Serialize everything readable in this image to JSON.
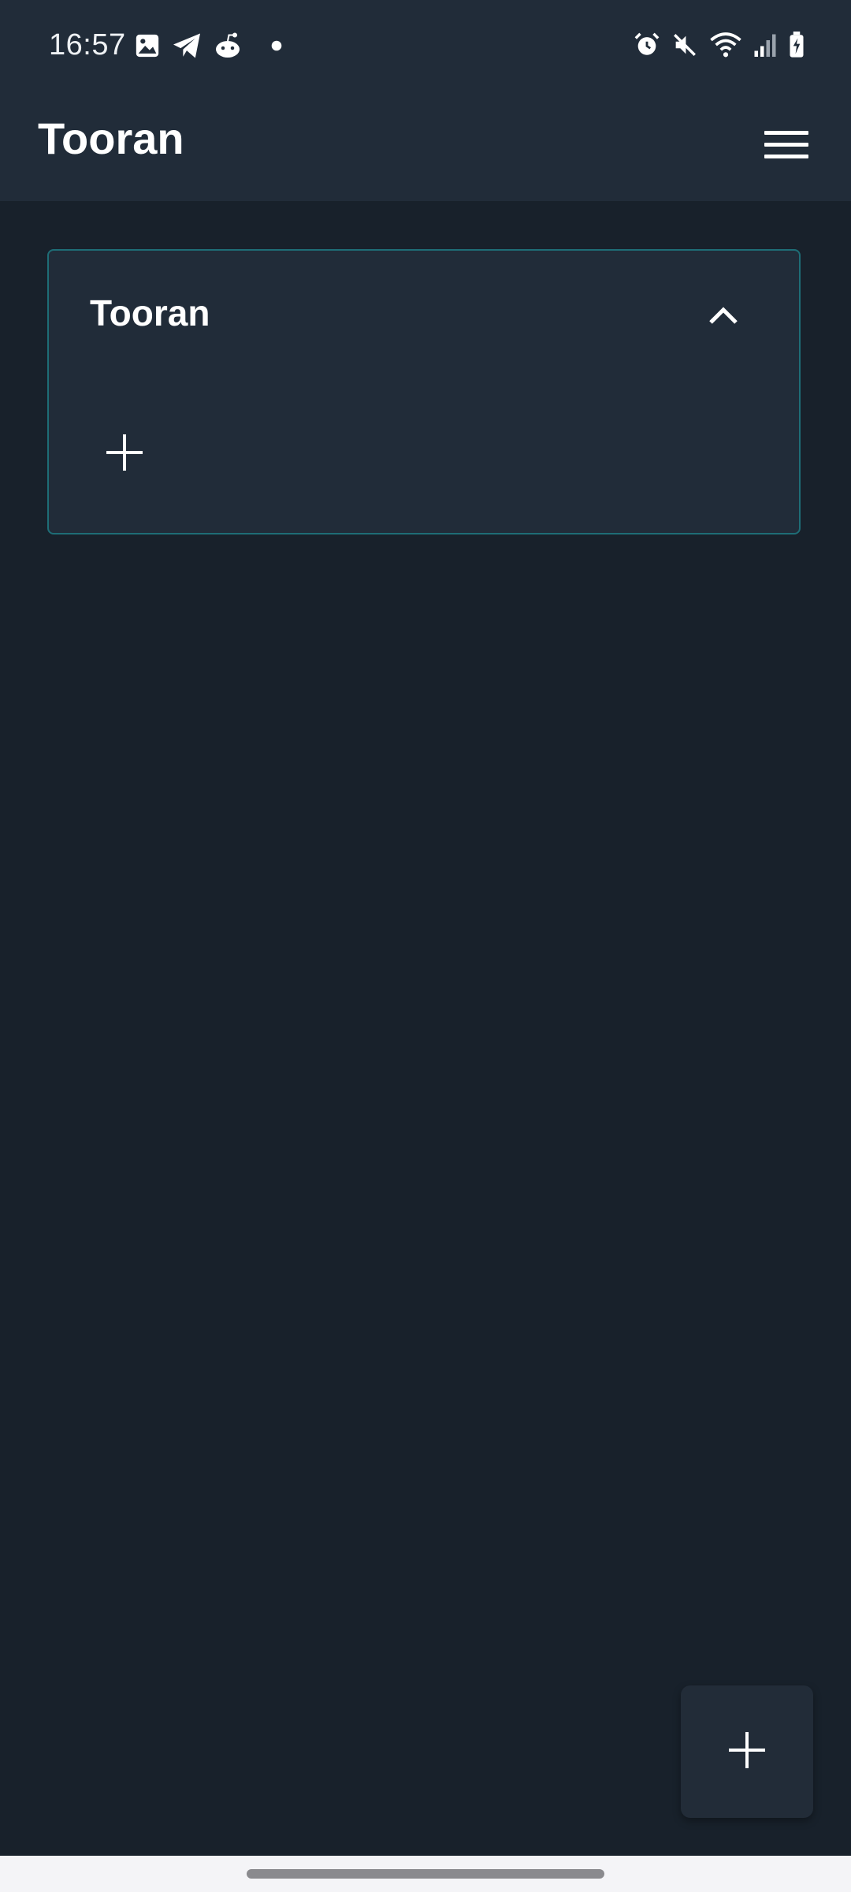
{
  "status_bar": {
    "time": "16:57",
    "left_icons": [
      "gallery-icon",
      "telegram-icon",
      "reddit-icon",
      "dot-icon"
    ],
    "right_icons": [
      "alarm-icon",
      "mute-icon",
      "wifi-icon",
      "signal-icon",
      "battery-charging-icon"
    ]
  },
  "app_bar": {
    "title": "Tooran",
    "menu_icon": "hamburger-menu-icon"
  },
  "board": {
    "title": "Tooran",
    "collapse_icon": "chevron-up-icon",
    "add_icon": "plus-icon"
  },
  "fab": {
    "icon": "plus-icon"
  },
  "colors": {
    "background": "#18212b",
    "surface": "#212c39",
    "card_border": "#1e6d76",
    "text": "#ffffff"
  }
}
